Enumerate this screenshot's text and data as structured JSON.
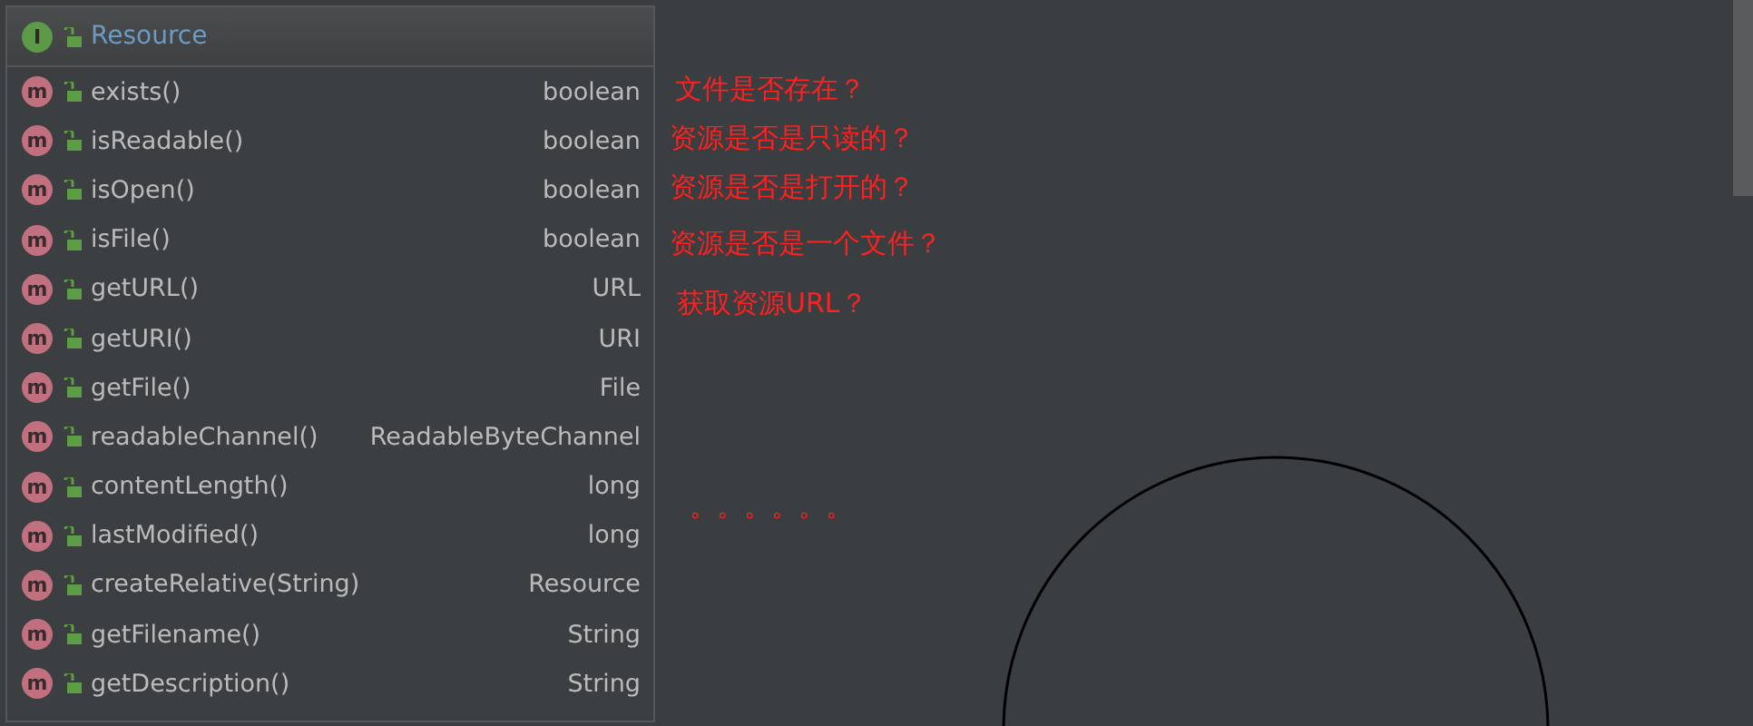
{
  "popup": {
    "icon": "I",
    "title": "Resource",
    "methods": [
      {
        "icon": "m",
        "name": "exists()",
        "type": "boolean"
      },
      {
        "icon": "m",
        "name": "isReadable()",
        "type": "boolean"
      },
      {
        "icon": "m",
        "name": "isOpen()",
        "type": "boolean"
      },
      {
        "icon": "m",
        "name": "isFile()",
        "type": "boolean"
      },
      {
        "icon": "m",
        "name": "getURL()",
        "type": "URL"
      },
      {
        "icon": "m",
        "name": "getURI()",
        "type": "URI"
      },
      {
        "icon": "m",
        "name": "getFile()",
        "type": "File"
      },
      {
        "icon": "m",
        "name": "readableChannel()",
        "type": "ReadableByteChannel"
      },
      {
        "icon": "m",
        "name": "contentLength()",
        "type": "long"
      },
      {
        "icon": "m",
        "name": "lastModified()",
        "type": "long"
      },
      {
        "icon": "m",
        "name": "createRelative(String)",
        "type": "Resource"
      },
      {
        "icon": "m",
        "name": "getFilename()",
        "type": "String"
      },
      {
        "icon": "m",
        "name": "getDescription()",
        "type": "String"
      }
    ]
  },
  "annotations": [
    {
      "text": "文件是否存在？"
    },
    {
      "text": "资源是否是只读的？"
    },
    {
      "text": "资源是否是打开的？"
    },
    {
      "text": "资源是否是一个文件？"
    },
    {
      "text": "获取资源URL？"
    },
    {
      "text": "。。。。。。"
    }
  ]
}
